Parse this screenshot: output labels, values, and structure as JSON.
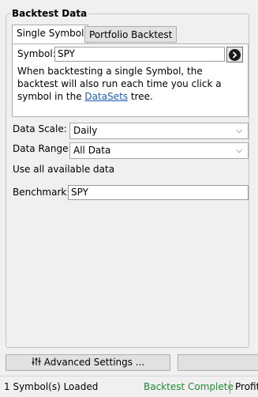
{
  "group": {
    "title": "Backtest Data"
  },
  "tabs": [
    {
      "label": "Single Symbol",
      "active": true
    },
    {
      "label": "Portfolio Backtest",
      "active": false
    }
  ],
  "single_symbol": {
    "symbol_label": "Symbol:",
    "symbol_value": "SPY",
    "description_text": "When backtesting a single Symbol, the backtest will also run each time you click a symbol in the ",
    "description_link": "DataSets",
    "description_tail": " tree."
  },
  "data_scale": {
    "label": "Data Scale:",
    "value": "Daily"
  },
  "data_range": {
    "label": "Data Range:",
    "value": "All Data",
    "note": "Use all available data"
  },
  "benchmark": {
    "label": "Benchmark:",
    "value": "SPY"
  },
  "buttons": {
    "advanced_settings": "Advanced Settings ..."
  },
  "status": {
    "loaded": "1 Symbol(s) Loaded",
    "backtest": "Backtest Complete",
    "profit": "Profit"
  },
  "colors": {
    "status_success": "#1e8f2e",
    "link": "#1a5fb4"
  },
  "icons": {
    "go": "circle-arrow-right-icon",
    "settings": "sliders-icon",
    "dropdown": "chevron-down-icon"
  }
}
